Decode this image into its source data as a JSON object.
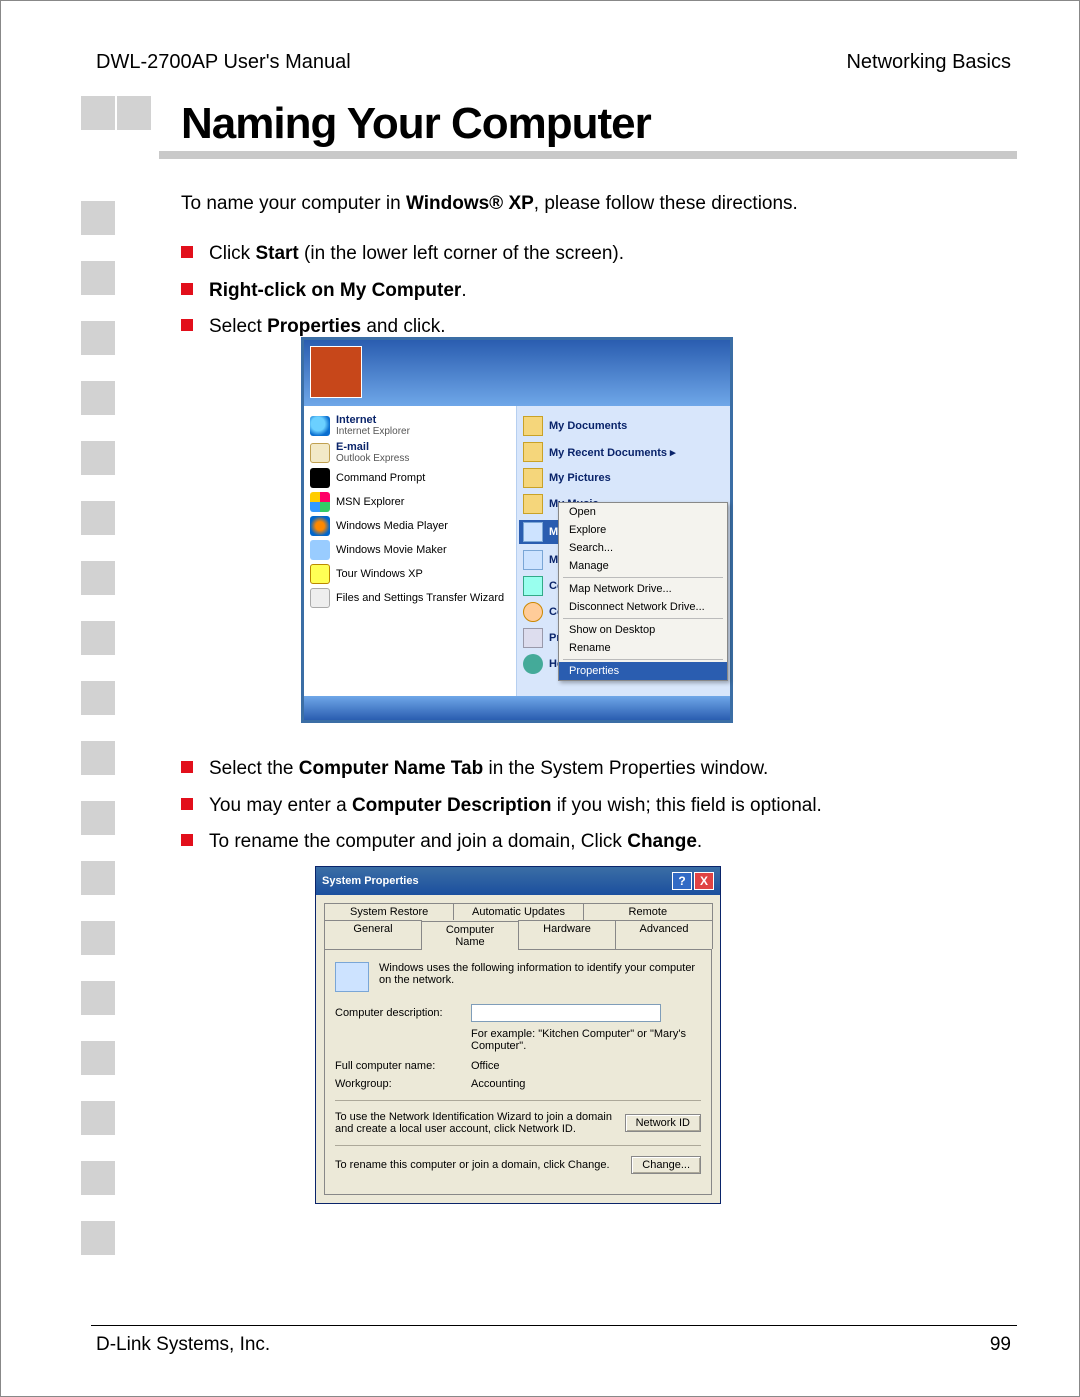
{
  "header": {
    "left": "DWL-2700AP User's Manual",
    "right": "Networking Basics"
  },
  "title": "Naming Your Computer",
  "intro_pre": "To name your computer in ",
  "intro_bold": "Windows® XP",
  "intro_post": ", please follow these directions.",
  "bullets1": [
    {
      "pre": "Click ",
      "b1": "Start",
      "post": " (in the lower left corner of the screen)."
    },
    {
      "bold_all": true,
      "pre": "",
      "b1": "Right-click",
      "mid": " on ",
      "b2": "My Computer",
      "post": "."
    },
    {
      "pre": "Select ",
      "b1": "Properties",
      "post": " and click."
    }
  ],
  "bullets2": [
    {
      "pre": "Select the ",
      "b1": "Computer Name Tab",
      "post": " in the System Properties window."
    },
    {
      "pre": "You may enter a ",
      "b1": "Computer Description",
      "post": " if you wish; this field is optional."
    },
    {
      "pre": "To rename the computer and join a domain, Click ",
      "b1": "Change",
      "post": "."
    }
  ],
  "start_menu": {
    "left": [
      {
        "t1": "Internet",
        "t2": "Internet Explorer",
        "ic": "ic-ie"
      },
      {
        "t1": "E-mail",
        "t2": "Outlook Express",
        "ic": "ic-mail"
      },
      {
        "t1": "Command Prompt",
        "t2": "",
        "ic": "ic-cmd"
      },
      {
        "t1": "MSN Explorer",
        "t2": "",
        "ic": "ic-msn"
      },
      {
        "t1": "Windows Media Player",
        "t2": "",
        "ic": "ic-wmp"
      },
      {
        "t1": "Windows Movie Maker",
        "t2": "",
        "ic": "ic-mm"
      },
      {
        "t1": "Tour Windows XP",
        "t2": "",
        "ic": "ic-tour"
      },
      {
        "t1": "Files and Settings Transfer Wizard",
        "t2": "",
        "ic": "ic-fs"
      }
    ],
    "right": [
      {
        "label": "My Documents",
        "ic": "ic-folder"
      },
      {
        "label": "My Recent Documents  ▸",
        "ic": "ic-folder"
      },
      {
        "label": "My Pictures",
        "ic": "ic-folder"
      },
      {
        "label": "My Music",
        "ic": "ic-folder"
      },
      {
        "label": "My Computer",
        "ic": "ic-pc",
        "highlight": true
      },
      {
        "label": "My Network",
        "ic": "ic-net"
      },
      {
        "label": "Control Panel",
        "ic": "ic-cp"
      },
      {
        "label": "Connect To",
        "ic": "ic-conn"
      },
      {
        "label": "Printers and F",
        "ic": "ic-prn"
      },
      {
        "label": "Help and Sup",
        "ic": "ic-help"
      }
    ],
    "context": [
      "Open",
      "Explore",
      "Search...",
      "Manage",
      "—",
      "Map Network Drive...",
      "Disconnect Network Drive...",
      "—",
      "Show on Desktop",
      "Rename",
      "—",
      "Properties"
    ]
  },
  "sysprops": {
    "title": "System Properties",
    "tabs_row1": [
      "System Restore",
      "Automatic Updates",
      "Remote"
    ],
    "tabs_row2": [
      "General",
      "Computer Name",
      "Hardware",
      "Advanced"
    ],
    "active_tab": "Computer Name",
    "info": "Windows uses the following information to identify your computer on the network.",
    "desc_label": "Computer description:",
    "desc_value": "",
    "desc_hint": "For example: \"Kitchen Computer\" or \"Mary's Computer\".",
    "fullname_label": "Full computer name:",
    "fullname_value": "Office",
    "workgroup_label": "Workgroup:",
    "workgroup_value": "Accounting",
    "netid_text": "To use the Network Identification Wizard to join a domain and create a local user account, click Network ID.",
    "netid_btn": "Network ID",
    "change_text": "To rename this computer or join a domain, click Change.",
    "change_btn": "Change..."
  },
  "footer": {
    "left": "D-Link Systems, Inc.",
    "right": "99"
  }
}
